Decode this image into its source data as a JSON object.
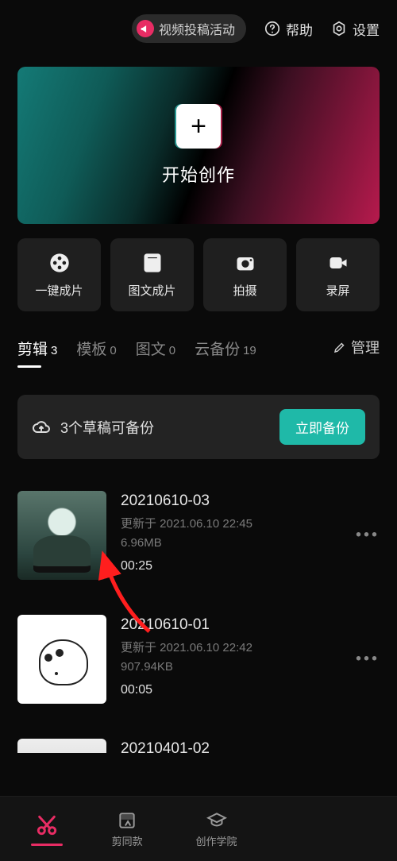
{
  "top": {
    "promo": "视频投稿活动",
    "help": "帮助",
    "settings": "设置"
  },
  "hero": {
    "label": "开始创作"
  },
  "tools": [
    {
      "label": "一键成片"
    },
    {
      "label": "图文成片"
    },
    {
      "label": "拍摄"
    },
    {
      "label": "录屏"
    }
  ],
  "tabs": {
    "edit_label": "剪辑",
    "edit_count": "3",
    "template_label": "模板",
    "template_count": "0",
    "text_label": "图文",
    "text_count": "0",
    "cloud_label": "云备份",
    "cloud_count": "19",
    "manage": "管理"
  },
  "backup": {
    "text": "3个草稿可备份",
    "button": "立即备份"
  },
  "drafts": [
    {
      "title": "20210610-03",
      "updated": "更新于 2021.06.10 22:45",
      "size": "6.96MB",
      "duration": "00:25"
    },
    {
      "title": "20210610-01",
      "updated": "更新于 2021.06.10 22:42",
      "size": "907.94KB",
      "duration": "00:05"
    },
    {
      "title": "20210401-02",
      "updated": "",
      "size": "",
      "duration": ""
    }
  ],
  "nav": {
    "same": "剪同款",
    "academy": "创作学院"
  }
}
